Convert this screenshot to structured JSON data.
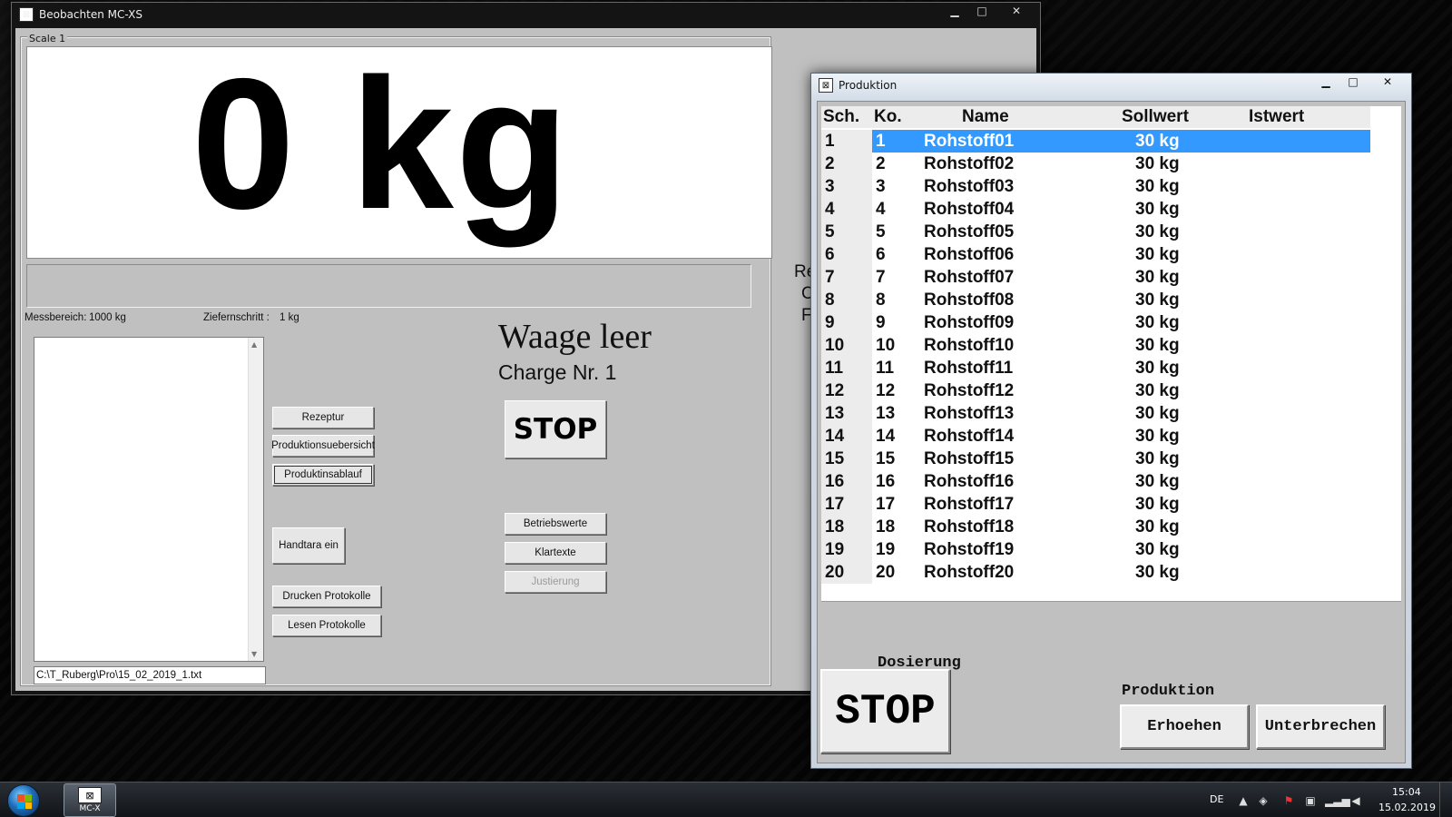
{
  "main_window": {
    "title": "Beobachten MC-XS",
    "group_label": "Scale 1",
    "weight_display": "0 kg",
    "messbereich_label": "Messbereich:",
    "messbereich_value": "1000 kg",
    "ziffernschritt_label": "Ziefernschritt :",
    "ziffernschritt_value": "1 kg",
    "status": "Waage leer",
    "charge": "Charge Nr. 1",
    "stop_label": "STOP",
    "path_value": "C:\\T_Ruberg\\Pro\\15_02_2019_1.txt",
    "buttons": {
      "rezeptur": "Rezeptur",
      "produktionsuebersicht": "Produktionsuebersicht",
      "produktinsablauf": "Produktinsablauf",
      "handtara": "Handtara ein",
      "drucken": "Drucken Protokolle",
      "lesen": "Lesen Protokolle",
      "betriebswerte": "Betriebswerte",
      "klartexte": "Klartexte",
      "justierung": "Justierung"
    },
    "peek": [
      "Re",
      "C",
      "F"
    ]
  },
  "produktion_window": {
    "title": "Produktion",
    "columns": [
      "Sch.",
      "Ko.",
      "Name",
      "Sollwert",
      "Istwert"
    ],
    "selected_index": 0,
    "rows": [
      {
        "sch": "1",
        "ko": "1",
        "name": "Rohstoff01",
        "sollwert": "30 kg",
        "istwert": ""
      },
      {
        "sch": "2",
        "ko": "2",
        "name": "Rohstoff02",
        "sollwert": "30 kg",
        "istwert": ""
      },
      {
        "sch": "3",
        "ko": "3",
        "name": "Rohstoff03",
        "sollwert": "30 kg",
        "istwert": ""
      },
      {
        "sch": "4",
        "ko": "4",
        "name": "Rohstoff04",
        "sollwert": "30 kg",
        "istwert": ""
      },
      {
        "sch": "5",
        "ko": "5",
        "name": "Rohstoff05",
        "sollwert": "30 kg",
        "istwert": ""
      },
      {
        "sch": "6",
        "ko": "6",
        "name": "Rohstoff06",
        "sollwert": "30 kg",
        "istwert": ""
      },
      {
        "sch": "7",
        "ko": "7",
        "name": "Rohstoff07",
        "sollwert": "30 kg",
        "istwert": ""
      },
      {
        "sch": "8",
        "ko": "8",
        "name": "Rohstoff08",
        "sollwert": "30 kg",
        "istwert": ""
      },
      {
        "sch": "9",
        "ko": "9",
        "name": "Rohstoff09",
        "sollwert": "30 kg",
        "istwert": ""
      },
      {
        "sch": "10",
        "ko": "10",
        "name": "Rohstoff10",
        "sollwert": "30 kg",
        "istwert": ""
      },
      {
        "sch": "11",
        "ko": "11",
        "name": "Rohstoff11",
        "sollwert": "30 kg",
        "istwert": ""
      },
      {
        "sch": "12",
        "ko": "12",
        "name": "Rohstoff12",
        "sollwert": "30 kg",
        "istwert": ""
      },
      {
        "sch": "13",
        "ko": "13",
        "name": "Rohstoff13",
        "sollwert": "30 kg",
        "istwert": ""
      },
      {
        "sch": "14",
        "ko": "14",
        "name": "Rohstoff14",
        "sollwert": "30 kg",
        "istwert": ""
      },
      {
        "sch": "15",
        "ko": "15",
        "name": "Rohstoff15",
        "sollwert": "30 kg",
        "istwert": ""
      },
      {
        "sch": "16",
        "ko": "16",
        "name": "Rohstoff16",
        "sollwert": "30 kg",
        "istwert": ""
      },
      {
        "sch": "17",
        "ko": "17",
        "name": "Rohstoff17",
        "sollwert": "30 kg",
        "istwert": ""
      },
      {
        "sch": "18",
        "ko": "18",
        "name": "Rohstoff18",
        "sollwert": "30 kg",
        "istwert": ""
      },
      {
        "sch": "19",
        "ko": "19",
        "name": "Rohstoff19",
        "sollwert": "30 kg",
        "istwert": ""
      },
      {
        "sch": "20",
        "ko": "20",
        "name": "Rohstoff20",
        "sollwert": "30 kg",
        "istwert": ""
      }
    ],
    "dosierung_label": "Dosierung",
    "dosierung_stop": "STOP",
    "produktion_label": "Produktion",
    "erhoehen": "Erhoehen",
    "unterbrechen": "Unterbrechen"
  },
  "taskbar": {
    "app_label": "MC-X",
    "language": "DE",
    "time": "15:04",
    "date": "15.02.2019"
  },
  "colors": {
    "selection": "#3399ff",
    "window_bg": "#c0c0c0",
    "desktop": "#050505"
  }
}
